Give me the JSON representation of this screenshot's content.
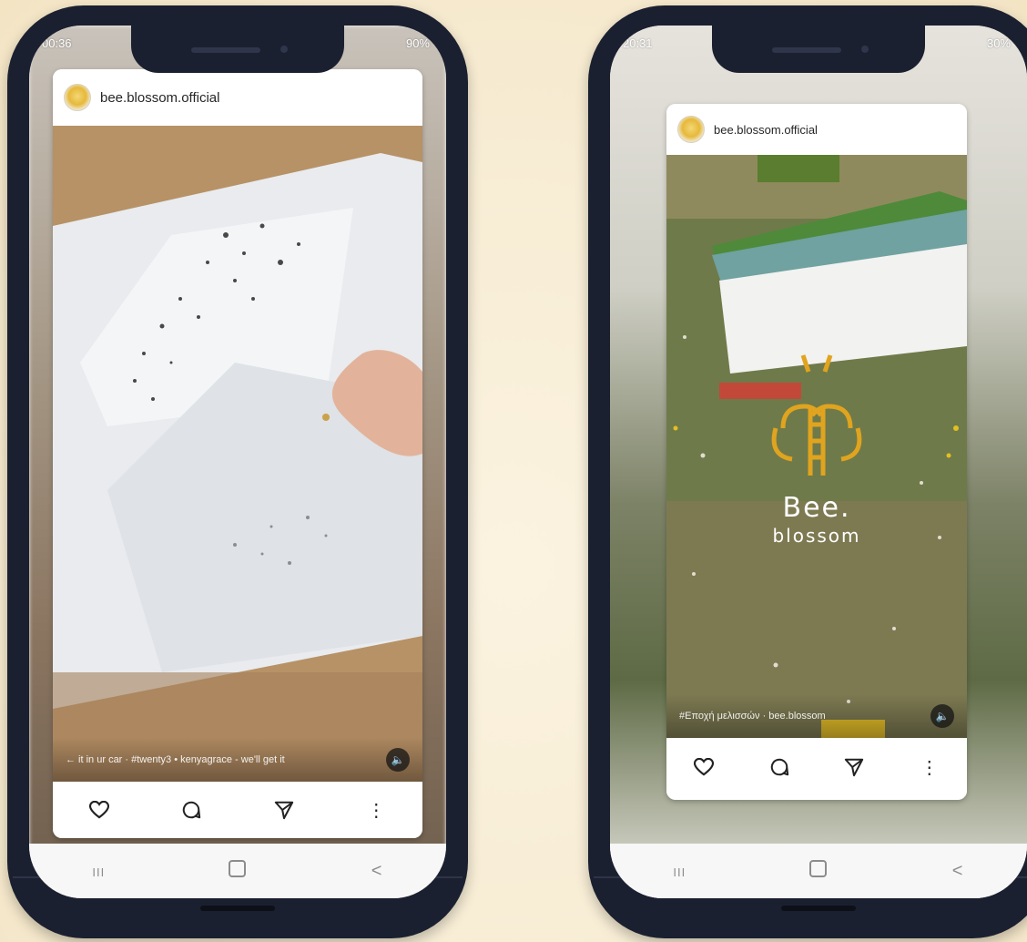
{
  "left_phone": {
    "status_time": "00:36",
    "status_right": "90%",
    "username": "bee.blossom.official",
    "music_text": "← it in ur car · #twenty3 • kenyagrace - we'll get it",
    "actions": [
      "heart-icon",
      "comment-icon",
      "share-icon",
      "more-icon"
    ],
    "nav": [
      "recents-icon",
      "home-icon",
      "back-icon"
    ]
  },
  "right_phone": {
    "status_time": "20:31",
    "status_right": "30%",
    "username": "bee.blossom.official",
    "brand_title": "Bee.",
    "brand_subtitle": "blossom",
    "music_text": "#Εποχή μελισσών · bee.blossom",
    "actions": [
      "heart-icon",
      "comment-icon",
      "share-icon",
      "more-icon"
    ],
    "nav": [
      "recents-icon",
      "home-icon",
      "back-icon"
    ]
  },
  "glyphs": {
    "volume": "🔈",
    "more": "⋮",
    "recents": "III",
    "back": "<"
  },
  "colors": {
    "phone_frame": "#1b2030",
    "background": "#f7ecd3",
    "brand_gold": "#e0a41e"
  }
}
